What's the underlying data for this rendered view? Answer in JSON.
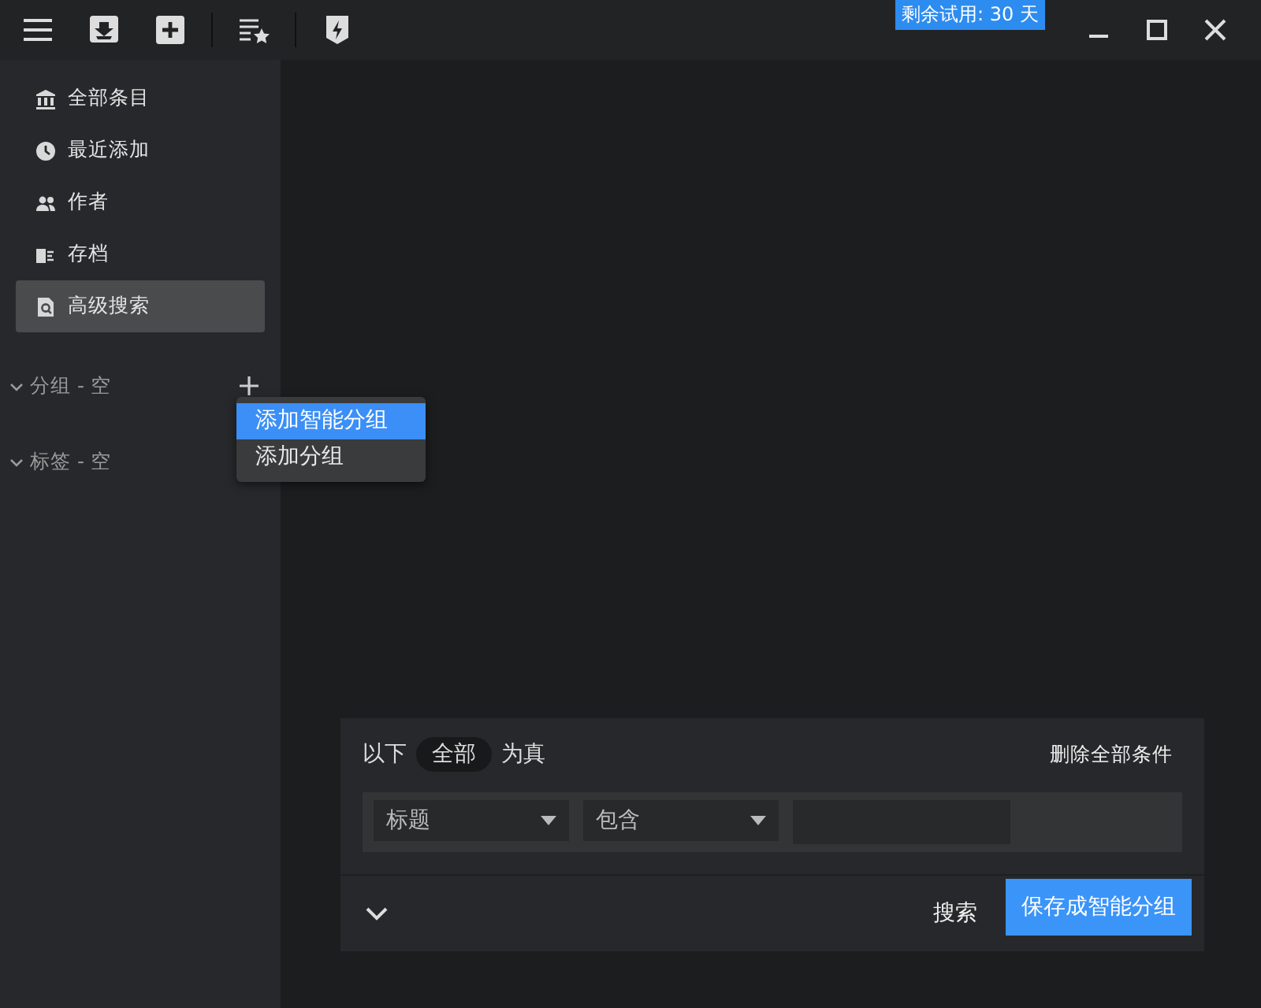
{
  "trial_badge": "剩余试用: 30 天",
  "sidebar": {
    "items": [
      {
        "label": "全部条目",
        "selected": false
      },
      {
        "label": "最近添加",
        "selected": false
      },
      {
        "label": "作者",
        "selected": false
      },
      {
        "label": "存档",
        "selected": false
      },
      {
        "label": "高级搜索",
        "selected": true
      }
    ],
    "sections": [
      {
        "label": "分组 - 空",
        "expanded": true,
        "add": true
      },
      {
        "label": "标签 - 空",
        "expanded": true,
        "add": false
      }
    ]
  },
  "context_menu": {
    "items": [
      {
        "label": "添加智能分组",
        "selected": true
      },
      {
        "label": "添加分组",
        "selected": false
      }
    ]
  },
  "search_panel": {
    "prefix": "以下",
    "match": "全部",
    "suffix": "为真",
    "delete_all": "删除全部条件",
    "conditions": [
      {
        "field": "标题",
        "operator": "包含"
      }
    ],
    "search_button": "搜索",
    "save_button": "保存成智能分组"
  }
}
